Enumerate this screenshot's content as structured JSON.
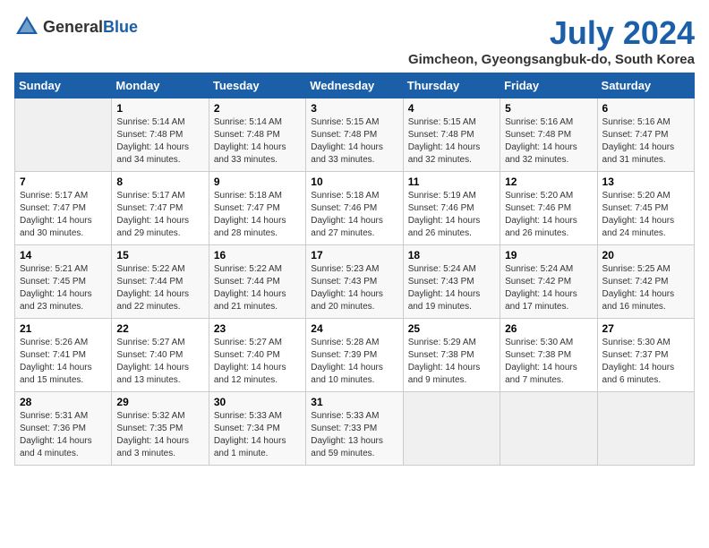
{
  "header": {
    "logo_general": "General",
    "logo_blue": "Blue",
    "main_title": "July 2024",
    "subtitle": "Gimcheon, Gyeongsangbuk-do, South Korea"
  },
  "weekdays": [
    "Sunday",
    "Monday",
    "Tuesday",
    "Wednesday",
    "Thursday",
    "Friday",
    "Saturday"
  ],
  "weeks": [
    [
      {
        "day": "",
        "sunrise": "",
        "sunset": "",
        "daylight": ""
      },
      {
        "day": "1",
        "sunrise": "Sunrise: 5:14 AM",
        "sunset": "Sunset: 7:48 PM",
        "daylight": "Daylight: 14 hours and 34 minutes."
      },
      {
        "day": "2",
        "sunrise": "Sunrise: 5:14 AM",
        "sunset": "Sunset: 7:48 PM",
        "daylight": "Daylight: 14 hours and 33 minutes."
      },
      {
        "day": "3",
        "sunrise": "Sunrise: 5:15 AM",
        "sunset": "Sunset: 7:48 PM",
        "daylight": "Daylight: 14 hours and 33 minutes."
      },
      {
        "day": "4",
        "sunrise": "Sunrise: 5:15 AM",
        "sunset": "Sunset: 7:48 PM",
        "daylight": "Daylight: 14 hours and 32 minutes."
      },
      {
        "day": "5",
        "sunrise": "Sunrise: 5:16 AM",
        "sunset": "Sunset: 7:48 PM",
        "daylight": "Daylight: 14 hours and 32 minutes."
      },
      {
        "day": "6",
        "sunrise": "Sunrise: 5:16 AM",
        "sunset": "Sunset: 7:47 PM",
        "daylight": "Daylight: 14 hours and 31 minutes."
      }
    ],
    [
      {
        "day": "7",
        "sunrise": "Sunrise: 5:17 AM",
        "sunset": "Sunset: 7:47 PM",
        "daylight": "Daylight: 14 hours and 30 minutes."
      },
      {
        "day": "8",
        "sunrise": "Sunrise: 5:17 AM",
        "sunset": "Sunset: 7:47 PM",
        "daylight": "Daylight: 14 hours and 29 minutes."
      },
      {
        "day": "9",
        "sunrise": "Sunrise: 5:18 AM",
        "sunset": "Sunset: 7:47 PM",
        "daylight": "Daylight: 14 hours and 28 minutes."
      },
      {
        "day": "10",
        "sunrise": "Sunrise: 5:18 AM",
        "sunset": "Sunset: 7:46 PM",
        "daylight": "Daylight: 14 hours and 27 minutes."
      },
      {
        "day": "11",
        "sunrise": "Sunrise: 5:19 AM",
        "sunset": "Sunset: 7:46 PM",
        "daylight": "Daylight: 14 hours and 26 minutes."
      },
      {
        "day": "12",
        "sunrise": "Sunrise: 5:20 AM",
        "sunset": "Sunset: 7:46 PM",
        "daylight": "Daylight: 14 hours and 26 minutes."
      },
      {
        "day": "13",
        "sunrise": "Sunrise: 5:20 AM",
        "sunset": "Sunset: 7:45 PM",
        "daylight": "Daylight: 14 hours and 24 minutes."
      }
    ],
    [
      {
        "day": "14",
        "sunrise": "Sunrise: 5:21 AM",
        "sunset": "Sunset: 7:45 PM",
        "daylight": "Daylight: 14 hours and 23 minutes."
      },
      {
        "day": "15",
        "sunrise": "Sunrise: 5:22 AM",
        "sunset": "Sunset: 7:44 PM",
        "daylight": "Daylight: 14 hours and 22 minutes."
      },
      {
        "day": "16",
        "sunrise": "Sunrise: 5:22 AM",
        "sunset": "Sunset: 7:44 PM",
        "daylight": "Daylight: 14 hours and 21 minutes."
      },
      {
        "day": "17",
        "sunrise": "Sunrise: 5:23 AM",
        "sunset": "Sunset: 7:43 PM",
        "daylight": "Daylight: 14 hours and 20 minutes."
      },
      {
        "day": "18",
        "sunrise": "Sunrise: 5:24 AM",
        "sunset": "Sunset: 7:43 PM",
        "daylight": "Daylight: 14 hours and 19 minutes."
      },
      {
        "day": "19",
        "sunrise": "Sunrise: 5:24 AM",
        "sunset": "Sunset: 7:42 PM",
        "daylight": "Daylight: 14 hours and 17 minutes."
      },
      {
        "day": "20",
        "sunrise": "Sunrise: 5:25 AM",
        "sunset": "Sunset: 7:42 PM",
        "daylight": "Daylight: 14 hours and 16 minutes."
      }
    ],
    [
      {
        "day": "21",
        "sunrise": "Sunrise: 5:26 AM",
        "sunset": "Sunset: 7:41 PM",
        "daylight": "Daylight: 14 hours and 15 minutes."
      },
      {
        "day": "22",
        "sunrise": "Sunrise: 5:27 AM",
        "sunset": "Sunset: 7:40 PM",
        "daylight": "Daylight: 14 hours and 13 minutes."
      },
      {
        "day": "23",
        "sunrise": "Sunrise: 5:27 AM",
        "sunset": "Sunset: 7:40 PM",
        "daylight": "Daylight: 14 hours and 12 minutes."
      },
      {
        "day": "24",
        "sunrise": "Sunrise: 5:28 AM",
        "sunset": "Sunset: 7:39 PM",
        "daylight": "Daylight: 14 hours and 10 minutes."
      },
      {
        "day": "25",
        "sunrise": "Sunrise: 5:29 AM",
        "sunset": "Sunset: 7:38 PM",
        "daylight": "Daylight: 14 hours and 9 minutes."
      },
      {
        "day": "26",
        "sunrise": "Sunrise: 5:30 AM",
        "sunset": "Sunset: 7:38 PM",
        "daylight": "Daylight: 14 hours and 7 minutes."
      },
      {
        "day": "27",
        "sunrise": "Sunrise: 5:30 AM",
        "sunset": "Sunset: 7:37 PM",
        "daylight": "Daylight: 14 hours and 6 minutes."
      }
    ],
    [
      {
        "day": "28",
        "sunrise": "Sunrise: 5:31 AM",
        "sunset": "Sunset: 7:36 PM",
        "daylight": "Daylight: 14 hours and 4 minutes."
      },
      {
        "day": "29",
        "sunrise": "Sunrise: 5:32 AM",
        "sunset": "Sunset: 7:35 PM",
        "daylight": "Daylight: 14 hours and 3 minutes."
      },
      {
        "day": "30",
        "sunrise": "Sunrise: 5:33 AM",
        "sunset": "Sunset: 7:34 PM",
        "daylight": "Daylight: 14 hours and 1 minute."
      },
      {
        "day": "31",
        "sunrise": "Sunrise: 5:33 AM",
        "sunset": "Sunset: 7:33 PM",
        "daylight": "Daylight: 13 hours and 59 minutes."
      },
      {
        "day": "",
        "sunrise": "",
        "sunset": "",
        "daylight": ""
      },
      {
        "day": "",
        "sunrise": "",
        "sunset": "",
        "daylight": ""
      },
      {
        "day": "",
        "sunrise": "",
        "sunset": "",
        "daylight": ""
      }
    ]
  ]
}
